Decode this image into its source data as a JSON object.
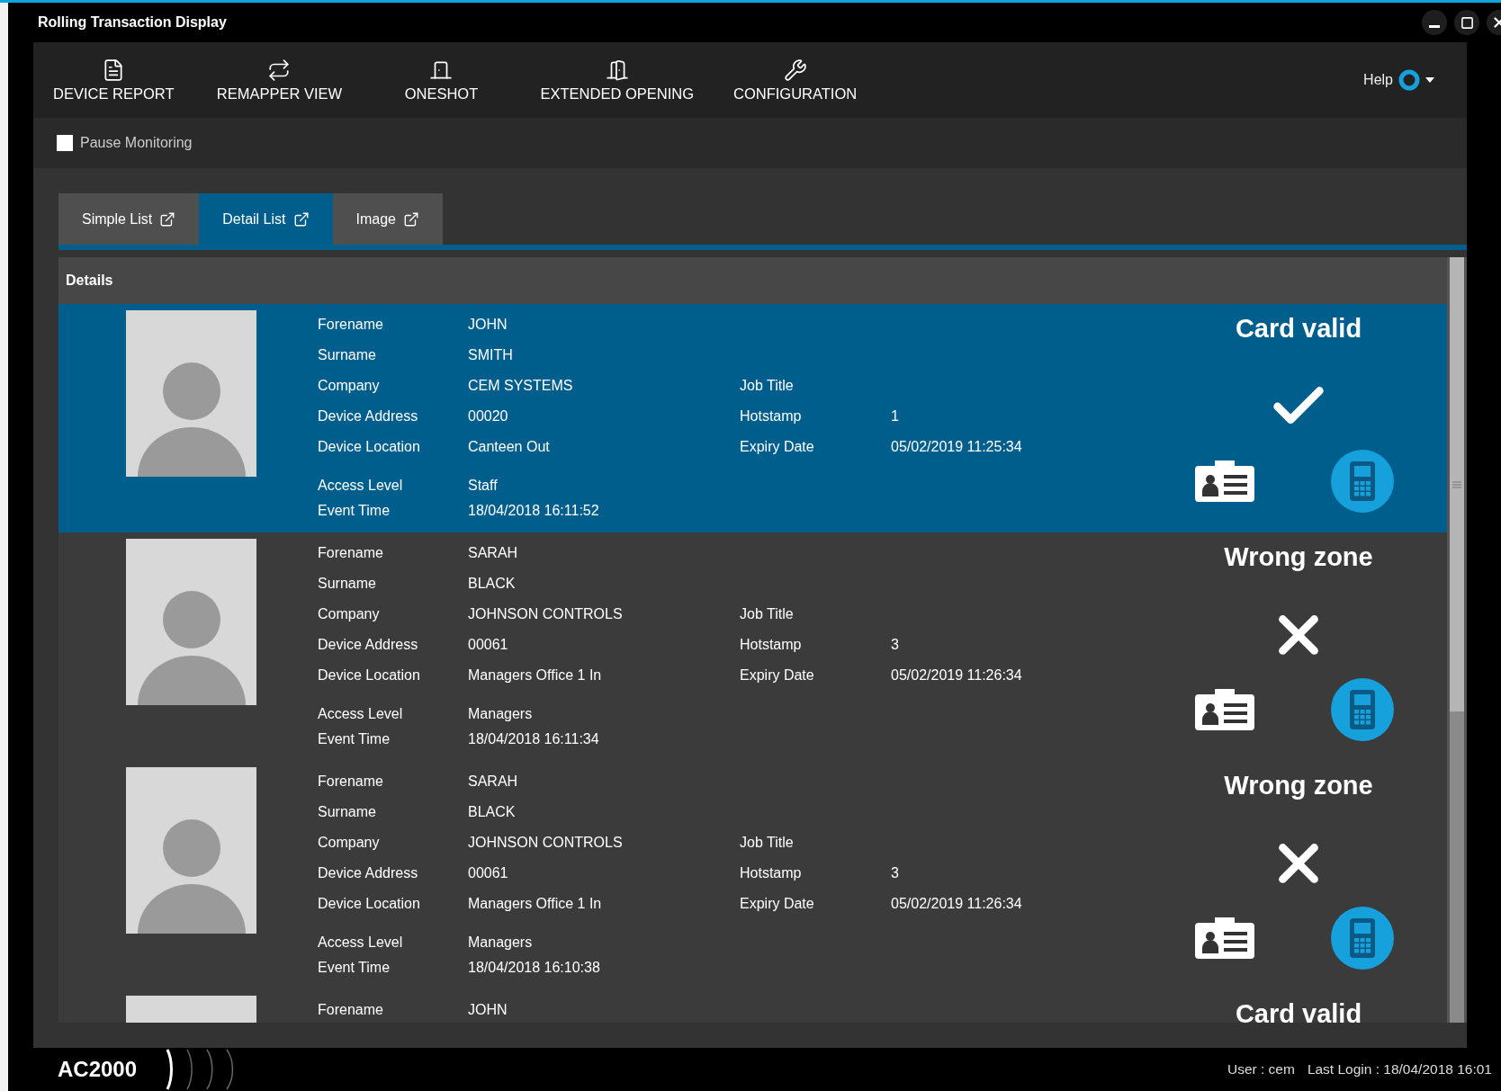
{
  "window": {
    "title": "Rolling Transaction Display"
  },
  "toolbar": [
    {
      "kind": "report",
      "label": "DEVICE REPORT"
    },
    {
      "kind": "remap",
      "label": "REMAPPER VIEW"
    },
    {
      "kind": "oneshot",
      "label": "ONESHOT"
    },
    {
      "kind": "extended",
      "label": "EXTENDED OPENING"
    },
    {
      "kind": "config",
      "label": "CONFIGURATION"
    }
  ],
  "help": {
    "label": "Help"
  },
  "pause": {
    "label": "Pause Monitoring",
    "checked": false
  },
  "tabs": [
    {
      "label": "Simple List",
      "selected": false
    },
    {
      "label": "Detail List",
      "selected": true
    },
    {
      "label": "Image",
      "selected": false
    }
  ],
  "details": {
    "title": "Details",
    "rows": [
      {
        "selected": true,
        "status": {
          "kind": "valid",
          "label": "Card valid"
        },
        "groups": [
          [
            [
              {
                "label": "Forename",
                "value": "JOHN"
              }
            ],
            [
              {
                "label": "Surname",
                "value": "SMITH"
              }
            ],
            [
              {
                "label": "Company",
                "value": "CEM SYSTEMS"
              },
              {
                "label": "Job Title"
              }
            ],
            [
              {
                "label": "Device Address",
                "value": "00020"
              },
              {
                "label": "Hotstamp",
                "value": "1"
              }
            ],
            [
              {
                "label": "Device Location",
                "value": "Canteen Out"
              },
              {
                "label": "Expiry Date",
                "value": "05/02/2019 11:25:34"
              }
            ]
          ],
          [
            [
              {
                "label": "Access Level",
                "value": "Staff"
              }
            ],
            [
              {
                "label": "Event Time",
                "value": "18/04/2018 16:11:52"
              }
            ]
          ]
        ]
      },
      {
        "selected": false,
        "status": {
          "kind": "invalid",
          "label": "Wrong zone"
        },
        "groups": [
          [
            [
              {
                "label": "Forename",
                "value": "SARAH"
              }
            ],
            [
              {
                "label": "Surname",
                "value": "BLACK"
              }
            ],
            [
              {
                "label": "Company",
                "value": "JOHNSON CONTROLS"
              },
              {
                "label": "Job Title"
              }
            ],
            [
              {
                "label": "Device Address",
                "value": "00061"
              },
              {
                "label": "Hotstamp",
                "value": "3"
              }
            ],
            [
              {
                "label": "Device Location",
                "value": "Managers Office 1 In"
              },
              {
                "label": "Expiry Date",
                "value": "05/02/2019 11:26:34"
              }
            ]
          ],
          [
            [
              {
                "label": "Access Level",
                "value": "Managers"
              }
            ],
            [
              {
                "label": "Event Time",
                "value": "18/04/2018 16:11:34"
              }
            ]
          ]
        ]
      },
      {
        "selected": false,
        "status": {
          "kind": "invalid",
          "label": "Wrong zone"
        },
        "groups": [
          [
            [
              {
                "label": "Forename",
                "value": "SARAH"
              }
            ],
            [
              {
                "label": "Surname",
                "value": "BLACK"
              }
            ],
            [
              {
                "label": "Company",
                "value": "JOHNSON CONTROLS"
              },
              {
                "label": "Job Title"
              }
            ],
            [
              {
                "label": "Device Address",
                "value": "00061"
              },
              {
                "label": "Hotstamp",
                "value": "3"
              }
            ],
            [
              {
                "label": "Device Location",
                "value": "Managers Office 1 In"
              },
              {
                "label": "Expiry Date",
                "value": "05/02/2019 11:26:34"
              }
            ]
          ],
          [
            [
              {
                "label": "Access Level",
                "value": "Managers"
              }
            ],
            [
              {
                "label": "Event Time",
                "value": "18/04/2018 16:10:38"
              }
            ]
          ]
        ]
      },
      {
        "selected": false,
        "status": {
          "kind": "valid",
          "label": "Card valid"
        },
        "groups": [
          [
            [
              {
                "label": "Forename",
                "value": "JOHN"
              }
            ]
          ]
        ]
      }
    ]
  },
  "footer": {
    "logo": "AC2000",
    "user": "User : cem",
    "last_login": "Last Login : 18/04/2018 16:01"
  }
}
